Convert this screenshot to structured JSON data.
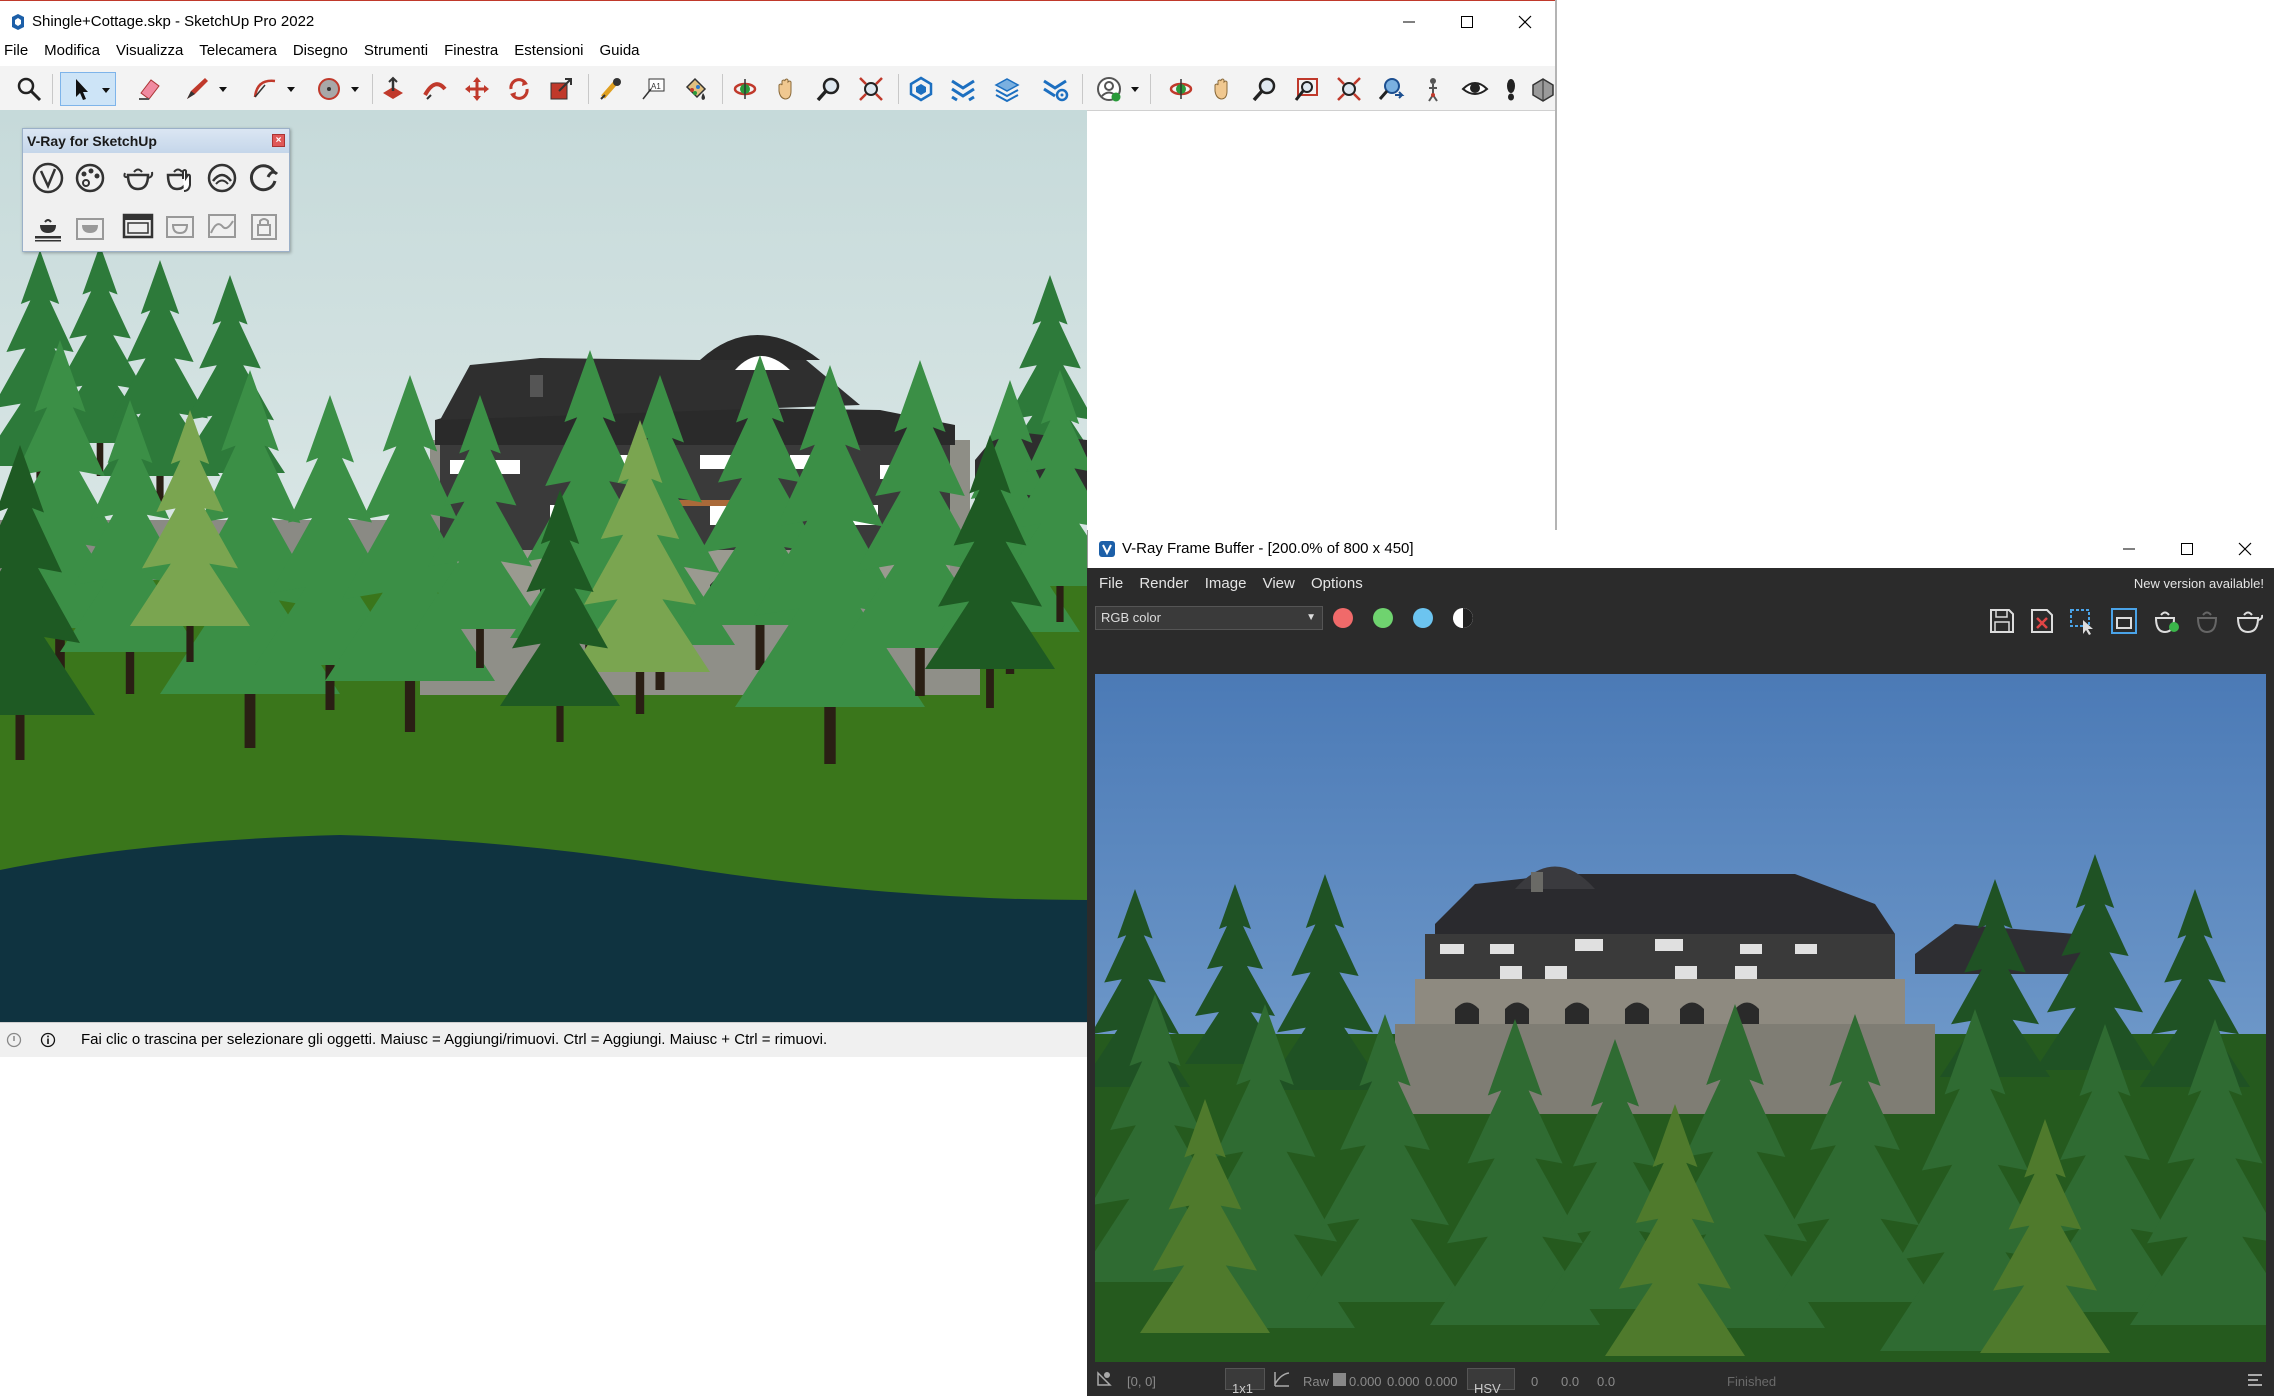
{
  "sketchup": {
    "title": "Shingle+Cottage.skp - SketchUp Pro 2022",
    "menu": [
      "File",
      "Modifica",
      "Visualizza",
      "Telecamera",
      "Disegno",
      "Strumenti",
      "Finestra",
      "Estensioni",
      "Guida"
    ],
    "status_message": "Fai clic o trascina per selezionare gli oggetti. Maiusc = Aggiungi/rimuovi. Ctrl = Aggiungi. Maiusc + Ctrl = rimuovi.",
    "colors": {
      "sky_top": "#c9dcdc",
      "sky_bottom": "#eef3f1",
      "grass": "#3f7a1c",
      "water": "#0f3340",
      "accent": "#c0392b"
    }
  },
  "vray_toolbar": {
    "title": "V-Ray for SketchUp",
    "row1_icons": [
      "vray-logo-icon",
      "asset-editor-icon",
      "render-teapot-icon",
      "interactive-render-icon",
      "render-cloud-icon",
      "refresh-icon"
    ],
    "row2_icons": [
      "denoiser-icon",
      "lightmix-icon",
      "frame-buffer-icon",
      "batch-render-icon",
      "lighting-analysis-icon",
      "lock-icon"
    ]
  },
  "frame_buffer": {
    "title": "V-Ray Frame Buffer - [200.0% of 800 x 450]",
    "menu": [
      "File",
      "Render",
      "Image",
      "View",
      "Options"
    ],
    "notice": "New version available!",
    "channel": "RGB color",
    "channel_colors": [
      "#f06a6a",
      "#6fd36f",
      "#6cc4f0"
    ],
    "status": {
      "coords": "[0, 0]",
      "zoom": "1x1",
      "raw_label": "Raw",
      "rgb_values": [
        "0.000",
        "0.000",
        "0.000"
      ],
      "color_mode": "HSV",
      "hsv_values": [
        "0",
        "0.0",
        "0.0"
      ],
      "state": "Finished"
    },
    "colors": {
      "bg": "#2b2b2b",
      "sky": "#6d98c8"
    }
  }
}
